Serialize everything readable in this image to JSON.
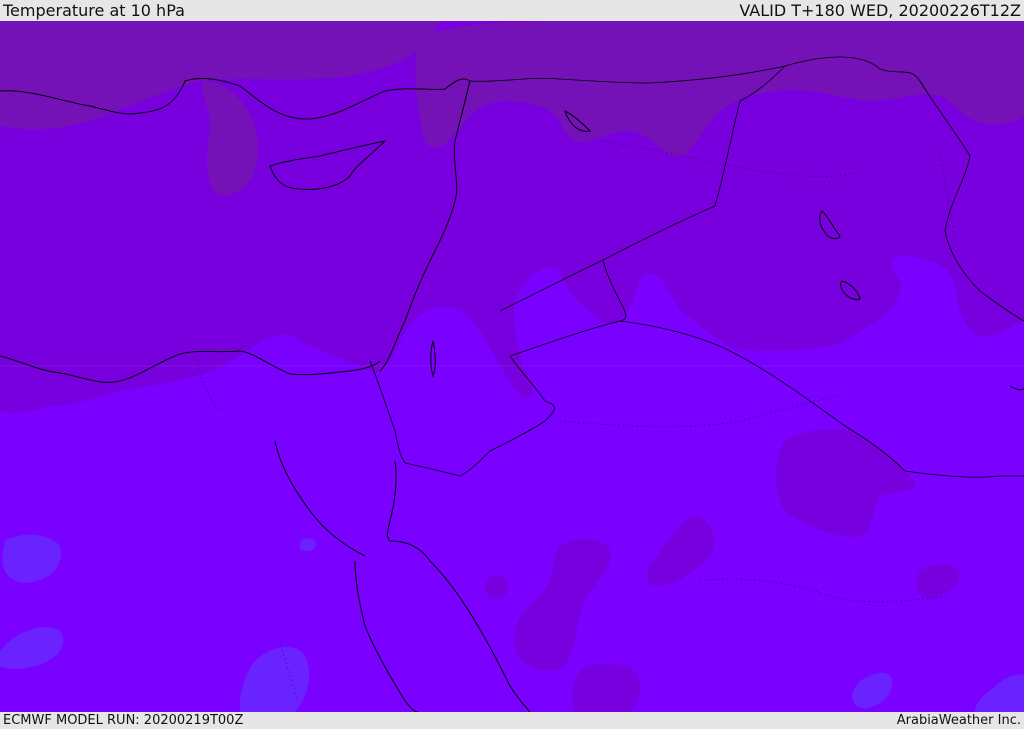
{
  "header": {
    "title": "Temperature at 10 hPa",
    "valid_time": "VALID T+180 WED, 20200226T12Z"
  },
  "footer": {
    "model_run": "ECMWF MODEL RUN: 20200219T00Z",
    "credit": "ArabiaWeather Inc."
  },
  "colors": {
    "base_field": "#7a00ff",
    "warmer_field": "#7900de",
    "warmest_field": "#7412b8",
    "cool_patch": "#6a23ff",
    "bar_background": "#e6e6e6",
    "coastline": "#000000"
  }
}
